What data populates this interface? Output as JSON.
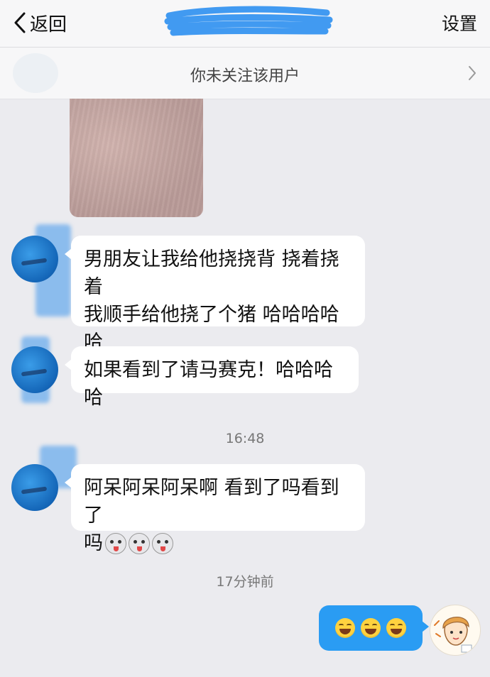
{
  "nav": {
    "back_label": "返回",
    "settings_label": "设置"
  },
  "follow_bar": {
    "text": "你未关注该用户"
  },
  "messages": [
    {
      "lines": [
        "男朋友让我给他挠挠背 挠着挠着",
        "我顺手给他挠了个猪 哈哈哈哈哈",
        "哈"
      ]
    },
    {
      "lines": [
        "如果看到了请马赛克！哈哈哈哈"
      ]
    },
    {
      "lines": [
        "阿呆阿呆阿呆啊 看到了吗看到了",
        "吗"
      ]
    }
  ],
  "timestamps": [
    "16:48",
    "17分钟前"
  ],
  "colors": {
    "background": "#ebebef",
    "outgoing_bubble": "#2a9cf3",
    "redaction": "#2c8ff0"
  },
  "icons": {
    "back": "chevron-left-icon",
    "follow_chevron": "chevron-right-icon",
    "dog_emoji": "husky-emoji-icon",
    "laugh_emoji": "tears-of-joy-emoji-icon"
  }
}
